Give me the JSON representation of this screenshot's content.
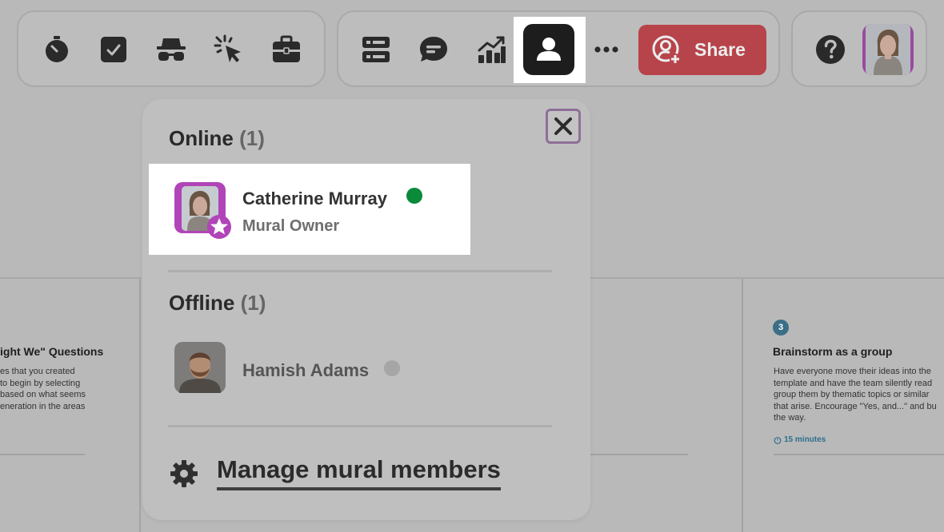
{
  "toolbar_left": {
    "tools": [
      {
        "name": "timer-icon"
      },
      {
        "name": "voting-icon"
      },
      {
        "name": "private-mode-icon"
      },
      {
        "name": "laser-pointer-icon"
      },
      {
        "name": "toolkit-icon"
      }
    ]
  },
  "toolbar_center": {
    "tools": [
      {
        "name": "outline-icon"
      },
      {
        "name": "comments-icon"
      },
      {
        "name": "activity-chart-icon"
      },
      {
        "name": "collaborators-icon",
        "active": true
      },
      {
        "name": "more-icon"
      }
    ],
    "share_label": "Share",
    "share_color": "#b7444a"
  },
  "toolbar_right": {
    "help_icon": "help-icon"
  },
  "members_panel": {
    "online": {
      "title": "Online",
      "count": "(1)"
    },
    "offline": {
      "title": "Offline",
      "count": "(1)"
    },
    "online_members": [
      {
        "name": "Catherine Murray",
        "role": "Mural Owner",
        "status_color": "#0a8a3a"
      }
    ],
    "offline_members": [
      {
        "name": "Hamish Adams",
        "status_color": "#a6a6a6"
      }
    ],
    "manage_label": "Manage mural members"
  },
  "background": {
    "left_card": {
      "title": "ight We\" Questions",
      "text": "es that you created\nto begin by selecting\nbased on what seems\neneration in the areas"
    },
    "right_card": {
      "step": "3",
      "title": "Brainstorm as a group",
      "text": "Have everyone move their ideas into the\ntemplate and have the team silently read\ngroup them by thematic topics or similar\nthat arise. Encourage \"Yes, and...\" and bu\nthe way.",
      "time": "15 minutes"
    }
  }
}
